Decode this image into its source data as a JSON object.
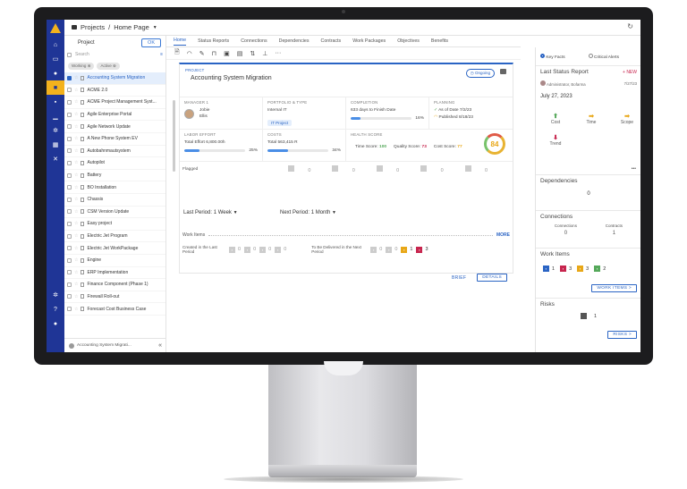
{
  "breadcrumb": {
    "section": "Projects",
    "separator": "/",
    "page": "Home Page"
  },
  "sidebar_left": {
    "items": [
      "home",
      "laptop",
      "location",
      "briefcase",
      "chat",
      "chart",
      "gear",
      "grid",
      "tools",
      "settings",
      "help",
      "user"
    ]
  },
  "project_list": {
    "header": "Project",
    "ok_label": "OK",
    "search_placeholder": "Search",
    "filters": [
      "Working",
      "Active"
    ],
    "items": [
      "Accounting System Migration",
      "ACME 2.0",
      "ACME Project Management Syst...",
      "Agile Enterprise Portal",
      "Agile Network Update",
      "A New Phone System EV",
      "Autobahnmautsystem",
      "Autopilot",
      "Battery",
      "BO Installation",
      "Chassis",
      "CSM Version Update",
      "Easy project",
      "Electric Jet Program",
      "Electric Jet WorkPackage",
      "Engine",
      "ERP Implementation",
      "Finance Component (Phase 1)",
      "Firewall Roll-out",
      "Forecast Cost Business Case"
    ],
    "selected_index": 0,
    "footer": "Accounting System Migrati...",
    "collapse": "«"
  },
  "tabs": [
    "Home",
    "Status Reports",
    "Connections",
    "Dependencies",
    "Contracts",
    "Work Packages",
    "Objectives",
    "Benefits"
  ],
  "toolbar_icons": [
    "document-icon",
    "wifi-icon",
    "pencil-icon",
    "lock-icon",
    "save-icon",
    "table-icon",
    "sync-icon",
    "hierarchy-icon",
    "more-icon"
  ],
  "project": {
    "label": "PROJECT",
    "name": "Accounting System Migration",
    "status": "Ongoing",
    "manager": {
      "label": "MANAGER 1",
      "first": "Jobie",
      "last": "Ellis"
    },
    "portfolio": {
      "label": "PORTFOLIO & TYPE",
      "org": "Internal IT",
      "type": "IT Project"
    },
    "completion": {
      "label": "COMPLETION",
      "days": "633",
      "days_text": "days to Finish Date",
      "percent": 16,
      "percent_text": "16%"
    },
    "planning": {
      "label": "PLANNING",
      "asof_label": "As of Date",
      "asof": "7/2/23",
      "published_label": "Published",
      "published": "8/18/23"
    },
    "labor": {
      "label": "LABOR EFFORT",
      "total_label": "Total Effort",
      "total": "6,800.00h",
      "percent": 25,
      "percent_text": "25%"
    },
    "costs": {
      "label": "COSTS",
      "total_label": "Total",
      "total": "563,415 R",
      "percent": 34,
      "percent_text": "34%"
    },
    "health": {
      "label": "HEALTH SCORE",
      "time_label": "Time Score:",
      "time": "100",
      "quality_label": "Quality Score:",
      "quality": "73",
      "cost_label": "Cost Score:",
      "cost": "77",
      "overall": "84"
    },
    "flagged": {
      "label": "Flagged",
      "values": [
        "0",
        "0",
        "0",
        "0",
        "0"
      ]
    },
    "last_period": {
      "label": "Last Period:",
      "value": "1 Week"
    },
    "next_period": {
      "label": "Next Period:",
      "value": "1 Month"
    },
    "work_items": {
      "label": "Work Items",
      "more": "MORE",
      "created_label": "Created in the Last Period",
      "created": [
        "0",
        "0",
        "0",
        "0"
      ],
      "deliver_label": "To Be Delivered in the Next Period",
      "deliver": [
        "0",
        "0",
        "1",
        "3"
      ]
    },
    "brief": "BRIEF",
    "details": "DETAILS"
  },
  "right_panel": {
    "key_facts": "Key Facts",
    "critical_alerts": "Critical Alerts",
    "last_status": "Last Status Report",
    "new": "+ NEW",
    "author": "Administrator, Bofarma",
    "report_date": "7/27/23",
    "date_big": "July 27, 2023",
    "kpis": [
      "Cost",
      "Time",
      "Scope",
      "Trend"
    ],
    "more": "•••",
    "dependencies": {
      "title": "Dependencies",
      "value": "0"
    },
    "connections": {
      "title": "Connections",
      "connections_label": "Connections",
      "connections": "0",
      "contracts_label": "Contracts",
      "contracts": "1"
    },
    "work_items": {
      "title": "Work Items",
      "counts": [
        "1",
        "3",
        "3",
        "2"
      ],
      "button": "WORK ITEMS >"
    },
    "risks": {
      "title": "Risks",
      "count": "1",
      "button": "RISKS >"
    }
  },
  "colors": {
    "rail": "#1f3596",
    "accent": "#2a64c4",
    "brand_yellow": "#f3b21d",
    "red": "#c7254e",
    "green": "#55a85a",
    "orange": "#e8a717"
  }
}
